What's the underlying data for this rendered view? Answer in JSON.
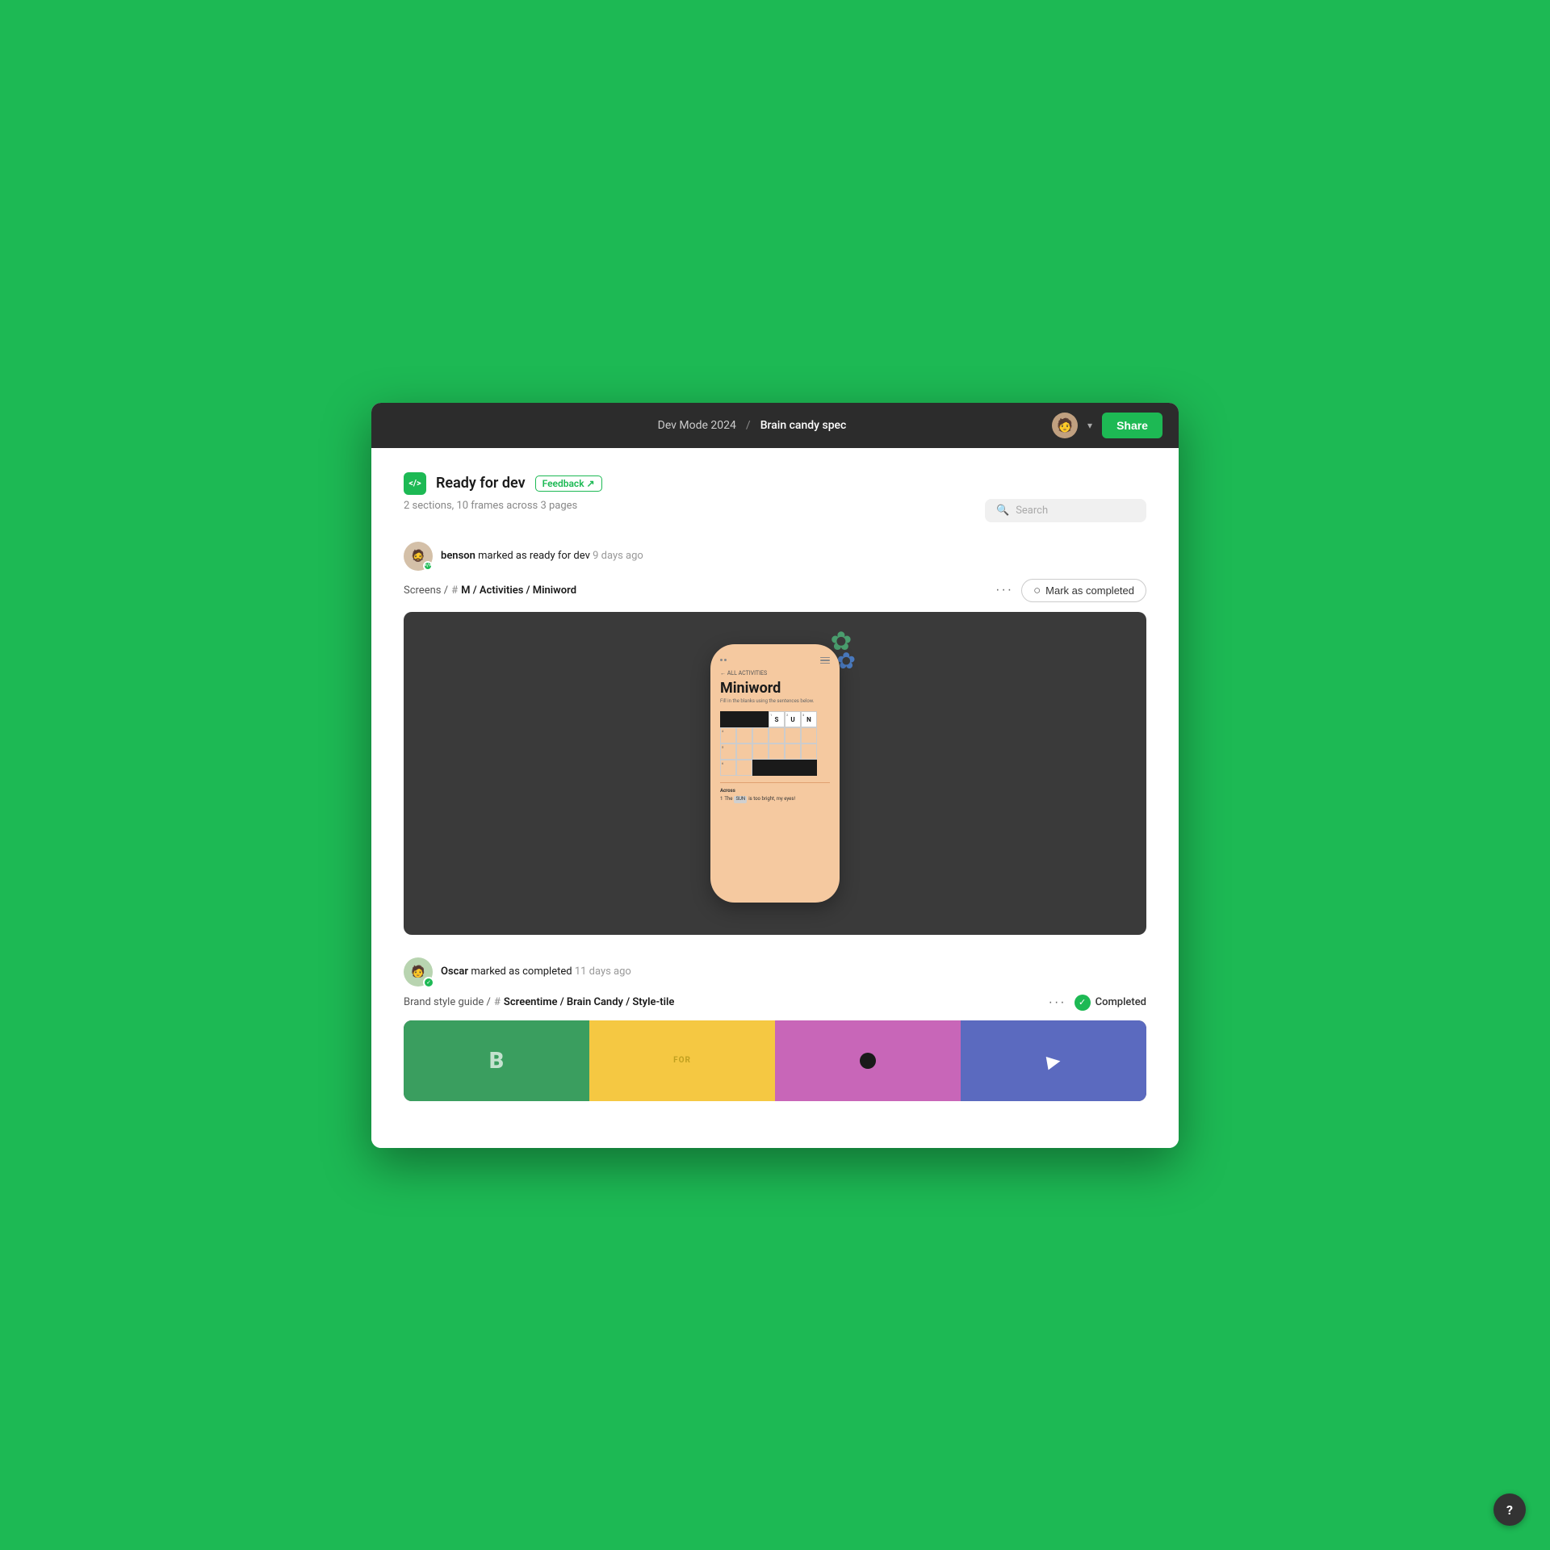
{
  "app": {
    "bg_color": "#1db954"
  },
  "titlebar": {
    "project": "Dev Mode 2024",
    "separator": "/",
    "file": "Brain candy spec",
    "share_label": "Share"
  },
  "header": {
    "icon_label": "</>",
    "ready_title": "Ready for dev",
    "feedback_label": "Feedback ↗",
    "sections_info": "2 sections, 10 frames across 3 pages",
    "search_placeholder": "Search"
  },
  "activity1": {
    "user": "benson",
    "action": "marked as ready for dev",
    "time": "9 days ago",
    "breadcrumb_pre": "Screens /",
    "breadcrumb_hash": "#",
    "frame_name": "M / Activities / Miniword",
    "mark_completed_label": "Mark as completed",
    "phone": {
      "back_link": "← ALL ACTIVITIES",
      "title": "Miniword",
      "subtitle": "Fill in the blanks using the\nsentences below.",
      "across_label": "Across",
      "clue_number": "1",
      "clue_pre": "The",
      "clue_word": "SUN",
      "clue_post": "is too\nbright, my eyes!"
    }
  },
  "activity2": {
    "user": "Oscar",
    "action": "marked as completed",
    "time": "11 days ago",
    "breadcrumb_pre": "Brand style guide /",
    "breadcrumb_hash": "#",
    "frame_name": "Screentime / Brain Candy / Style-tile",
    "completed_label": "Completed"
  },
  "help": {
    "label": "?"
  }
}
